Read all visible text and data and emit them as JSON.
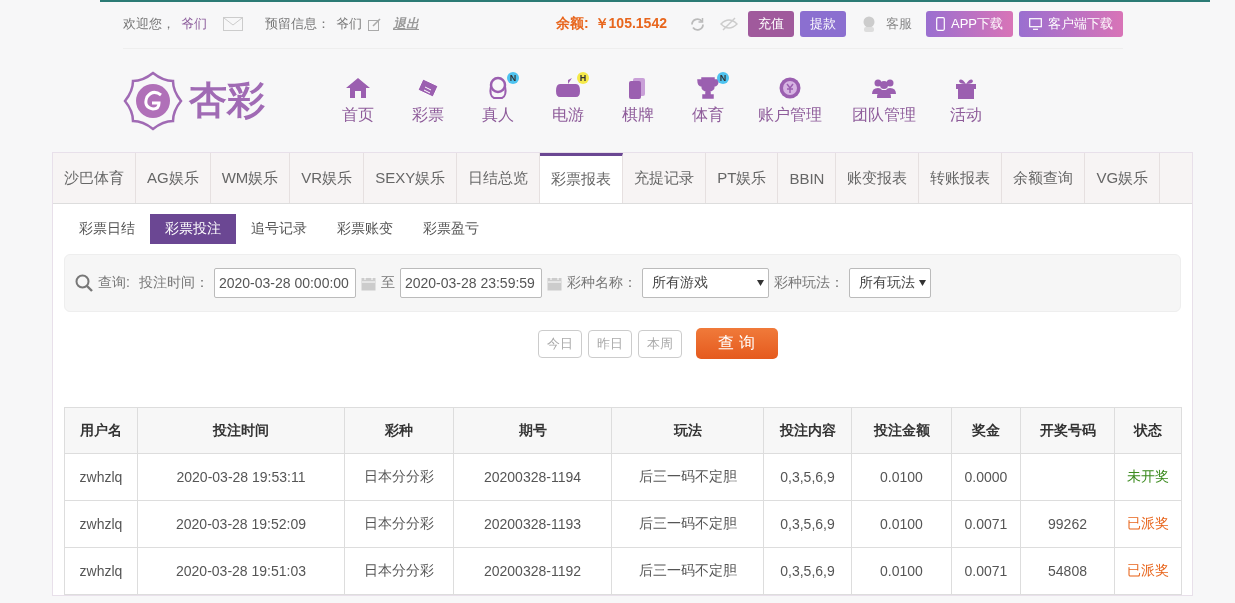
{
  "top_bar": {
    "welcome": "欢迎您，",
    "username": "爷们",
    "reserved_label": "预留信息：",
    "reserved_value": "爷们",
    "logout": "退出",
    "balance_label": "余额:",
    "balance": "￥105.1542",
    "deposit": "充值",
    "withdraw": "提款",
    "service": "客服",
    "app_download": "APP下载",
    "client_download": "客户端下载"
  },
  "logo": {
    "text": "杏彩"
  },
  "nav": [
    {
      "label": "首页"
    },
    {
      "label": "彩票"
    },
    {
      "label": "真人",
      "badge": "N"
    },
    {
      "label": "电游",
      "badge": "H"
    },
    {
      "label": "棋牌"
    },
    {
      "label": "体育",
      "badge": "N"
    },
    {
      "label": "账户管理"
    },
    {
      "label": "团队管理"
    },
    {
      "label": "活动"
    }
  ],
  "tabs": [
    {
      "label": "沙巴体育",
      "selected": false
    },
    {
      "label": "AG娱乐",
      "selected": false
    },
    {
      "label": "WM娱乐",
      "selected": false
    },
    {
      "label": "VR娱乐",
      "selected": false
    },
    {
      "label": "SEXY娱乐",
      "selected": false
    },
    {
      "label": "日结总览",
      "selected": false
    },
    {
      "label": "彩票报表",
      "selected": true
    },
    {
      "label": "充提记录",
      "selected": false
    },
    {
      "label": "PT娱乐",
      "selected": false
    },
    {
      "label": "BBIN",
      "selected": false
    },
    {
      "label": "账变报表",
      "selected": false
    },
    {
      "label": "转账报表",
      "selected": false
    },
    {
      "label": "余额查询",
      "selected": false
    },
    {
      "label": "VG娱乐",
      "selected": false
    }
  ],
  "sub_tabs": [
    {
      "label": "彩票日结",
      "selected": false
    },
    {
      "label": "彩票投注",
      "selected": true
    },
    {
      "label": "追号记录",
      "selected": false
    },
    {
      "label": "彩票账变",
      "selected": false
    },
    {
      "label": "彩票盈亏",
      "selected": false
    }
  ],
  "filter": {
    "query_label": "查询:",
    "time_label": "投注时间：",
    "start": "2020-03-28 00:00:00",
    "to": "至",
    "end": "2020-03-28 23:59:59",
    "game_label": "彩种名称：",
    "game": "所有游戏",
    "play_label": "彩种玩法：",
    "play": "所有玩法"
  },
  "quick_buttons": [
    "今日",
    "昨日",
    "本周"
  ],
  "search_button": "查 询",
  "table": {
    "columns": [
      "用户名",
      "投注时间",
      "彩种",
      "期号",
      "玩法",
      "投注内容",
      "投注金额",
      "奖金",
      "开奖号码",
      "状态"
    ],
    "rows": [
      {
        "cells": [
          "zwhzlq",
          "2020-03-28 19:53:11",
          "日本分分彩",
          "20200328-1194",
          "后三一码不定胆",
          "0,3,5,6,9",
          "0.0100",
          "0.0000",
          "",
          "未开奖"
        ],
        "color": "#3b8a1e"
      },
      {
        "cells": [
          "zwhzlq",
          "2020-03-28 19:52:09",
          "日本分分彩",
          "20200328-1193",
          "后三一码不定胆",
          "0,3,5,6,9",
          "0.0100",
          "0.0071",
          "99262",
          "已派奖"
        ],
        "color": "#e8661d"
      },
      {
        "cells": [
          "zwhzlq",
          "2020-03-28 19:51:03",
          "日本分分彩",
          "20200328-1192",
          "后三一码不定胆",
          "0,3,5,6,9",
          "0.0100",
          "0.0071",
          "54808",
          "已派奖"
        ],
        "color": "#e8661d"
      }
    ]
  }
}
